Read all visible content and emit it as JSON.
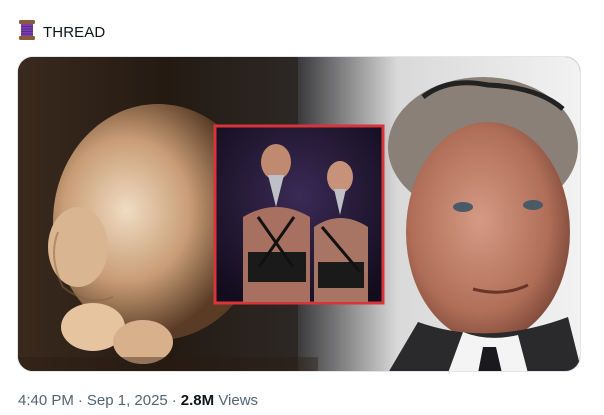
{
  "header": {
    "icon": "spool-of-thread-icon",
    "label": "THREAD"
  },
  "meta": {
    "time": "4:40 PM",
    "separator": "·",
    "date": "Sep 1, 2025",
    "views_count": "2.8M",
    "views_label": "Views"
  },
  "colors": {
    "text_primary": "#0f1419",
    "text_secondary": "#536471",
    "inset_border": "#d9343a",
    "media_border": "#e1e6ea"
  }
}
